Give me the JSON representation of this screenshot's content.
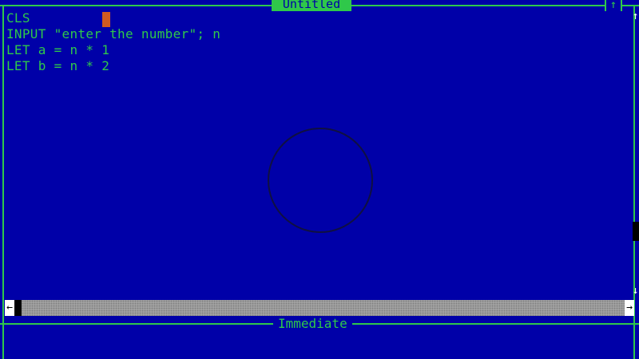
{
  "window": {
    "title": "Untitled",
    "maximize_glyph": "↑"
  },
  "editor": {
    "lines": [
      "CLS",
      "INPUT \"enter the number\"; n",
      "LET a = n * 1",
      "LET b = n * 2"
    ]
  },
  "scrollbar": {
    "up_arrow": "↑",
    "down_arrow": "↓",
    "left_arrow": "←",
    "right_arrow": "→"
  },
  "immediate": {
    "title": "Immediate"
  },
  "colors": {
    "background": "#0000a8",
    "text": "#2fc84a",
    "cursor": "#d05a20"
  }
}
